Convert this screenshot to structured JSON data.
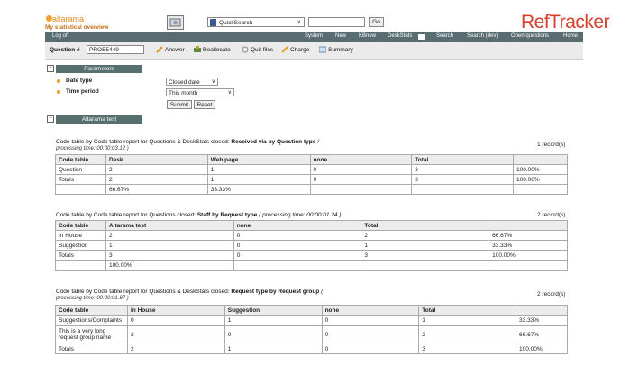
{
  "header": {
    "logo": "altarama",
    "subtitle": "My statistical overview",
    "brand": "RefTracker",
    "quicksearch_value": "QuickSearch",
    "go_label": "Go"
  },
  "nav": {
    "logoff": "Log off",
    "items": [
      "System",
      "New",
      "KBnew",
      "DeskStats",
      "Search",
      "Search (dev)",
      "Open questions",
      "Home"
    ]
  },
  "toolbar": {
    "question_label": "Question #",
    "question_value": "PROB5449",
    "actions": [
      "Answer",
      "Reallocate",
      "Quit files",
      "Charge",
      "Summary"
    ]
  },
  "parameters": {
    "title": "Parameters",
    "date_type_label": "Date type",
    "date_type_value": "Closed date",
    "time_period_label": "Time period",
    "time_period_value": "This month",
    "submit_label": "Submit",
    "reset_label": "Reset"
  },
  "altarama_test": {
    "title": "Altarama test"
  },
  "reports": [
    {
      "title_prefix": "Code table by Code table report for Questions & DeskStats closed:",
      "title_bold": "Received via by Question type",
      "time_inline": "/",
      "time_below": "processing time: 00:00:03.12 )",
      "records": "1 record(s)",
      "headers": [
        "Code table",
        "Desk",
        "Web page",
        "none",
        "Total",
        ""
      ],
      "rows": [
        [
          "Question",
          "2",
          "1",
          "0",
          "3",
          "100.00%"
        ],
        [
          "Totals",
          "2",
          "1",
          "0",
          "3",
          "100.00%"
        ],
        [
          "",
          "66.67%",
          "33.33%",
          "",
          "",
          ""
        ]
      ]
    },
    {
      "title_prefix": "Code table by Code table report for Questions closed:",
      "title_bold": "Staff by Request type",
      "time_inline": "( processing time: 00:00:01.24 )",
      "time_below": "",
      "records": "2 record(s)",
      "headers": [
        "Code table",
        "Altarama test",
        "none",
        "Total",
        ""
      ],
      "rows": [
        [
          "In House",
          "2",
          "0",
          "2",
          "66.67%"
        ],
        [
          "Suggestion",
          "1",
          "0",
          "1",
          "33.33%"
        ],
        [
          "Totals",
          "3",
          "0",
          "3",
          "100.00%"
        ],
        [
          "",
          "100.00%",
          "",
          "",
          ""
        ]
      ]
    },
    {
      "title_prefix": "Code table by Code table report for Questions & DeskStats closed:",
      "title_bold": "Request type by Request group",
      "time_inline": "(",
      "time_below": "processing time: 00:00:01.87 )",
      "records": "2 record(s)",
      "headers": [
        "Code table",
        "In House",
        "Suggestion",
        "none",
        "Total",
        ""
      ],
      "rows": [
        [
          "Suggestions/Complaints",
          "0",
          "1",
          "0",
          "1",
          "33.33%"
        ],
        [
          "This is a very long request group name",
          "2",
          "0",
          "0",
          "2",
          "66.67%"
        ],
        [
          "Totals",
          "2",
          "1",
          "0",
          "3",
          "100.00%"
        ]
      ]
    }
  ],
  "colors": {
    "navbar": "#596c70",
    "section": "#56706f",
    "brand": "#d4402b",
    "accent": "#e89a2a"
  }
}
